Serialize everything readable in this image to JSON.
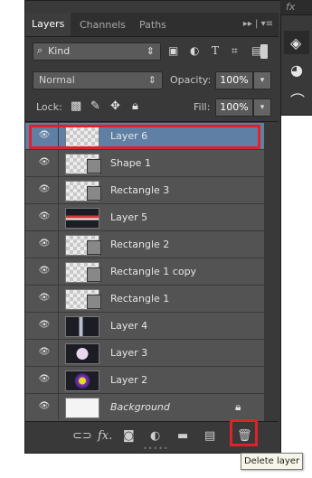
{
  "tabs": [
    "Layers",
    "Channels",
    "Paths"
  ],
  "tab_menu_icon": "panel-menu-icon",
  "filter": {
    "kind_label": "Kind",
    "icons": [
      "image-filter-icon",
      "adjustment-filter-icon",
      "type-filter-icon",
      "shape-filter-icon",
      "smart-object-filter-icon"
    ],
    "type_glyph": "T"
  },
  "blend": {
    "mode": "Normal",
    "opacity_label": "Opacity:",
    "opacity_value": "100%"
  },
  "lock": {
    "label": "Lock:",
    "fill_label": "Fill:",
    "fill_value": "100%"
  },
  "layers": [
    {
      "name": "Layer 6",
      "selected": true
    },
    {
      "name": "Shape 1",
      "selected": false
    },
    {
      "name": "Rectangle 3",
      "selected": false
    },
    {
      "name": "Layer 5",
      "selected": false
    },
    {
      "name": "Rectangle 2",
      "selected": false
    },
    {
      "name": "Rectangle 1 copy",
      "selected": false
    },
    {
      "name": "Rectangle 1",
      "selected": false
    },
    {
      "name": "Layer 4",
      "selected": false
    },
    {
      "name": "Layer 3",
      "selected": false
    },
    {
      "name": "Layer 2",
      "selected": false
    },
    {
      "name": "Background",
      "selected": false,
      "locked": true
    }
  ],
  "bottom_icons": [
    "link-layers-icon",
    "fx-icon",
    "layer-mask-icon",
    "adjustment-layer-icon",
    "new-group-icon",
    "new-layer-icon",
    "delete-layer-icon"
  ],
  "fx_label": "fx.",
  "tooltip": "Delete layer",
  "dock": {
    "fx_label": "fx"
  },
  "colors": {
    "panel": "#393939",
    "layer_bg": "#535353",
    "selected": "#5f7fa5",
    "highlight": "#e0202a"
  }
}
